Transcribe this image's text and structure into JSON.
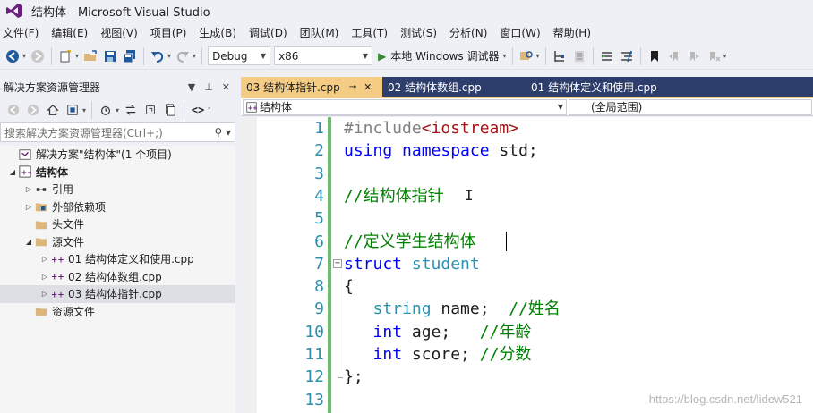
{
  "window": {
    "title": "结构体 - Microsoft Visual Studio"
  },
  "menu": [
    "文件(F)",
    "编辑(E)",
    "视图(V)",
    "项目(P)",
    "生成(B)",
    "调试(D)",
    "团队(M)",
    "工具(T)",
    "测试(S)",
    "分析(N)",
    "窗口(W)",
    "帮助(H)"
  ],
  "toolbar": {
    "config": "Debug",
    "platform": "x86",
    "run_label": "本地 Windows 调试器"
  },
  "solution_explorer": {
    "title": "解决方案资源管理器",
    "search_placeholder": "搜索解决方案资源管理器(Ctrl+;)",
    "items": [
      {
        "label": "解决方案\"结构体\"(1 个项目)",
        "expander": ""
      },
      {
        "label": "结构体",
        "expander": "◢"
      },
      {
        "label": "引用",
        "expander": "▷"
      },
      {
        "label": "外部依赖项",
        "expander": "▷"
      },
      {
        "label": "头文件",
        "expander": ""
      },
      {
        "label": "源文件",
        "expander": "◢"
      },
      {
        "label": "01 结构体定义和使用.cpp",
        "expander": "▷"
      },
      {
        "label": "02 结构体数组.cpp",
        "expander": "▷"
      },
      {
        "label": "03 结构体指针.cpp",
        "expander": "▷"
      },
      {
        "label": "资源文件",
        "expander": ""
      }
    ]
  },
  "tabs": [
    {
      "label": "03 结构体指针.cpp",
      "pin": "⊸",
      "close": "✕"
    },
    {
      "label": "02 结构体数组.cpp"
    },
    {
      "label": "01 结构体定义和使用.cpp"
    }
  ],
  "navbar": {
    "scope": "结构体",
    "member": "(全局范围)"
  },
  "editor": {
    "line_numbers": [
      "1",
      "2",
      "3",
      "4",
      "5",
      "6",
      "7",
      "8",
      "9",
      "10",
      "11",
      "12",
      "13"
    ],
    "code": {
      "l1_directive": "#include",
      "l1_header": "<iostream>",
      "l2_using": "using",
      "l2_namespace": "namespace",
      "l2_rest": " std;",
      "l4": "//结构体指针",
      "l6": "//定义学生结构体",
      "l7_kw": "struct",
      "l7_name": "student",
      "l8": "{",
      "l9_type": "string",
      "l9_rest": " name;  ",
      "l9_comment": "//姓名",
      "l10_type": "int",
      "l10_rest": " age;   ",
      "l10_comment": "//年龄",
      "l11_type": "int",
      "l11_rest": " score; ",
      "l11_comment": "//分数",
      "l12": "};"
    }
  },
  "watermark": "https://blog.csdn.net/lidew521",
  "colors": {
    "tab_active": "#f5cc84",
    "tab_strip": "#2d3e6c",
    "keyword": "#0000ff",
    "comment": "#008000",
    "type": "#2b91af",
    "change_bar": "#6dbd6d"
  }
}
